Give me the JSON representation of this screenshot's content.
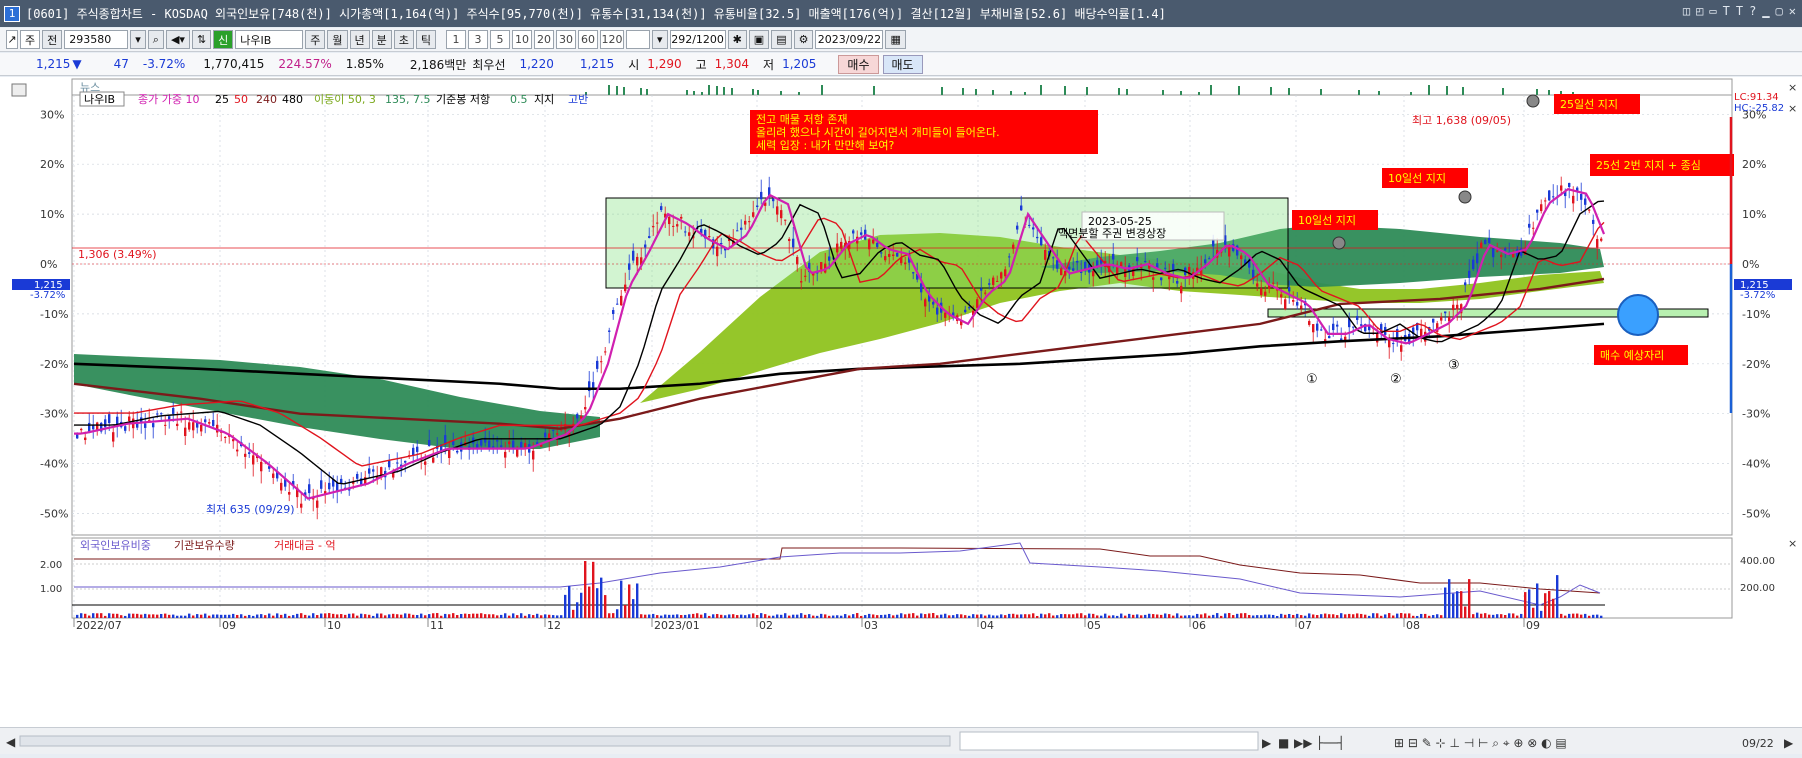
{
  "window": {
    "number": "1",
    "title": "[0601] 주식종합차트 - KOSDAQ 외국인보유[748(천)] 시가총액[1,164(억)] 주식수[95,770(천)] 유통수[31,134(천)] 유통비율[32.5] 매출액[176(억)] 결산[12월] 부채비율[52.6] 배당수익률[1.4]",
    "controls": [
      "◫",
      "◰",
      "▭",
      "T",
      "T",
      "?",
      "▁",
      "▢",
      "✕"
    ]
  },
  "toolbar": {
    "market": "주",
    "all": "전",
    "code": "293580",
    "name_badge": "신",
    "name": "나우IB",
    "periods": [
      "주",
      "월",
      "년",
      "분",
      "초",
      "틱"
    ],
    "minutes": [
      "1",
      "3",
      "5",
      "10",
      "20",
      "30",
      "60",
      "120"
    ],
    "count": "292/1200",
    "date": "2023/09/22"
  },
  "quote": {
    "price": "1,215",
    "arrow": "▼",
    "change": "47",
    "change_pct": "-3.72%",
    "volume": "1,770,415",
    "vol_ratio": "224.57%",
    "turnover": "1.85%",
    "amount": "2,186백만",
    "ask_label": "최우선",
    "ask": "1,220",
    "bid": "1,215",
    "open_label": "시",
    "open": "1,290",
    "high_label": "고",
    "high": "1,304",
    "low_label": "저",
    "low": "1,205",
    "buy": "매수",
    "sell": "매도"
  },
  "chart": {
    "news_label": "뉴스",
    "legend": {
      "name": "나우IB",
      "price_ma": "종가 가중 10",
      "ma25": "25",
      "ma50": "50",
      "ma240": "240",
      "ma480": "480",
      "ichimoku": "이동이 50, 3",
      "ichimoku2": "135, 7.5",
      "base": "기준봉 저항",
      "base_v": "0.5",
      "support": "지지",
      "high": "고반"
    },
    "y_ticks": [
      "30%",
      "20%",
      "10%",
      "0%",
      "-10%",
      "-20%",
      "-30%",
      "-40%",
      "-50%"
    ],
    "right_ticks": [
      "30%",
      "20%",
      "10%",
      "0%",
      "-10%",
      "-20%",
      "-30%",
      "-40%",
      "-50%"
    ],
    "ref_line_label": "1,306 (3.49%)",
    "cur_price_box": "1,215",
    "cur_pct": "-3.72%",
    "right_price_box": "1,215",
    "right_pct": "-3.72%",
    "lc": "LC:91.34",
    "hc": "HC:-25.82",
    "low_label": "최저 635 (09/29)",
    "high_label": "최고 1,638 (09/05)",
    "annotation_main": [
      "전고 매물 저항 존재",
      "올리려 했으나 시간이 길어지면서 개미들이 들어온다.",
      "세력 입장 : 내가 만만해 보여?"
    ],
    "note_box": [
      "2023-05-25",
      "액면분할 주권 변경상장"
    ],
    "tag_10a": "10일선 지지",
    "tag_10b": "10일선 지지",
    "tag_25": "25일선 지지",
    "tag_25b": "25선 2번 지지 + 종심",
    "tag_buy": "매수 예상자리",
    "circle1": "①",
    "circle2": "②",
    "circle3": "③"
  },
  "sub": {
    "legend1": "외국인보유비중",
    "legend2": "기관보유수량",
    "legend3": "거래대금 - 억",
    "ticks_left": [
      "2.00",
      "1.00"
    ],
    "ticks_right": [
      "400.00",
      "200.00"
    ]
  },
  "x_axis": {
    "labels": [
      "2022/07",
      "09",
      "10",
      "11",
      "12",
      "2023/01",
      "02",
      "03",
      "04",
      "05",
      "06",
      "07",
      "08",
      "09"
    ],
    "right_date": "09/22"
  },
  "colors": {
    "title_bg": "#4a5a6e",
    "up": "#e0141e",
    "down": "#1a3ad6",
    "cloud_dark": "#2e8b57",
    "cloud_light": "#8fc31f",
    "annotation_bg": "#ff0000",
    "annotation_text": "#ffff00"
  }
}
